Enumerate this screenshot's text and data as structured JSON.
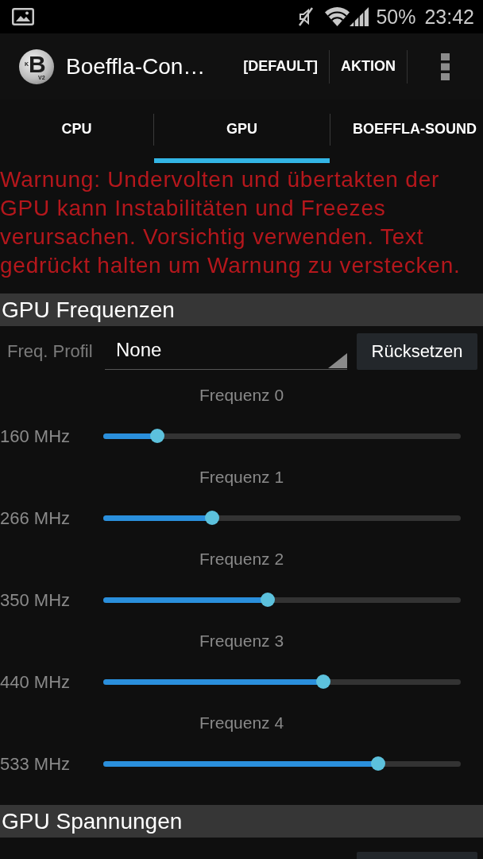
{
  "status_bar": {
    "battery": "50%",
    "time": "23:42"
  },
  "action_bar": {
    "logo": {
      "prefix": "K",
      "letter": "B",
      "suffix": "V2"
    },
    "title": "Boeffla-Con…",
    "actions": [
      "[DEFAULT]",
      "AKTION"
    ]
  },
  "tabs": [
    {
      "label": "CPU",
      "selected": false
    },
    {
      "label": "GPU",
      "selected": true
    },
    {
      "label": "BOEFFLA-SOUND",
      "selected": false
    }
  ],
  "warning": "Warnung: Undervolten und übertakten der GPU kann Instabilitäten und Freezes verursachen. Vorsichtig verwenden. Text gedrückt halten um Warnung zu verstecken.",
  "sections": [
    {
      "title": "GPU Frequenzen",
      "profile": {
        "label": "Freq. Profil",
        "value": "None",
        "button": "Rücksetzen"
      },
      "sliders": [
        {
          "label": "Frequenz 0",
          "reading": "160 MHz",
          "level": 0.151
        },
        {
          "label": "Frequenz 1",
          "reading": "266 MHz",
          "level": 0.304
        },
        {
          "label": "Frequenz 2",
          "reading": "350 MHz",
          "level": 0.46
        },
        {
          "label": "Frequenz 3",
          "reading": "440 MHz",
          "level": 0.616
        },
        {
          "label": "Frequenz 4",
          "reading": "533 MHz",
          "level": 0.769
        }
      ]
    },
    {
      "title": "GPU Spannungen"
    }
  ]
}
